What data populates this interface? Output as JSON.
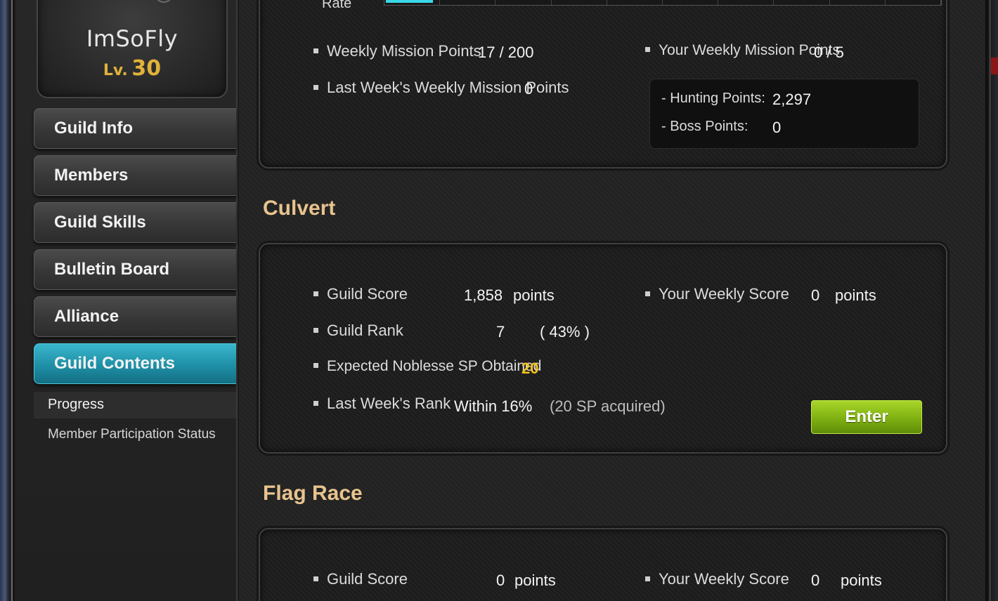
{
  "profile": {
    "name": "ImSoFly",
    "level_prefix": "Lv.",
    "level": "30"
  },
  "nav": {
    "items": [
      {
        "label": "Guild Info"
      },
      {
        "label": "Members"
      },
      {
        "label": "Guild Skills"
      },
      {
        "label": "Bulletin Board"
      },
      {
        "label": "Alliance"
      },
      {
        "label": "Guild Contents"
      }
    ],
    "active_index": 5,
    "sub_items": [
      {
        "label": "Progress"
      },
      {
        "label": "Member Participation Status"
      }
    ]
  },
  "mission": {
    "rate_label": "Rate",
    "rate_fill_fraction": 0.085,
    "weekly_mission_points_label": "Weekly Mission Points",
    "weekly_mission_points_value": "17 / 200",
    "your_weekly_mission_points_label": "Your Weekly Mission Points",
    "your_weekly_mission_points_value": "0 / 5",
    "last_week_label": "Last Week's Weekly Mission Points",
    "last_week_value": "0",
    "hunting_points_label": "- Hunting Points:",
    "hunting_points_value": "2,297",
    "boss_points_label": "- Boss Points:",
    "boss_points_value": "0"
  },
  "culvert": {
    "title": "Culvert",
    "guild_score_label": "Guild Score",
    "guild_score_value": "1,858",
    "points_unit": "points",
    "your_weekly_score_label": "Your Weekly Score",
    "your_weekly_score_value": "0",
    "guild_rank_label": "Guild Rank",
    "guild_rank_value": "7",
    "guild_rank_percent": "( 43% )",
    "noblesse_label": "Expected Noblesse SP Obtained",
    "noblesse_value": "20",
    "last_week_rank_label": "Last Week's Rank",
    "last_week_rank_value": "Within 16%",
    "last_week_rank_note": "(20 SP acquired)",
    "enter_label": "Enter"
  },
  "flag_race": {
    "title": "Flag Race",
    "guild_score_label": "Guild Score",
    "guild_score_value": "0",
    "points_unit": "points",
    "your_weekly_score_label": "Your Weekly Score",
    "your_weekly_score_value": "0"
  },
  "colors": {
    "accent_active": "#1e8fa6",
    "section_title": "#e8c38e",
    "highlight_value": "#f2c21a",
    "enter_button": "#7fb012"
  }
}
